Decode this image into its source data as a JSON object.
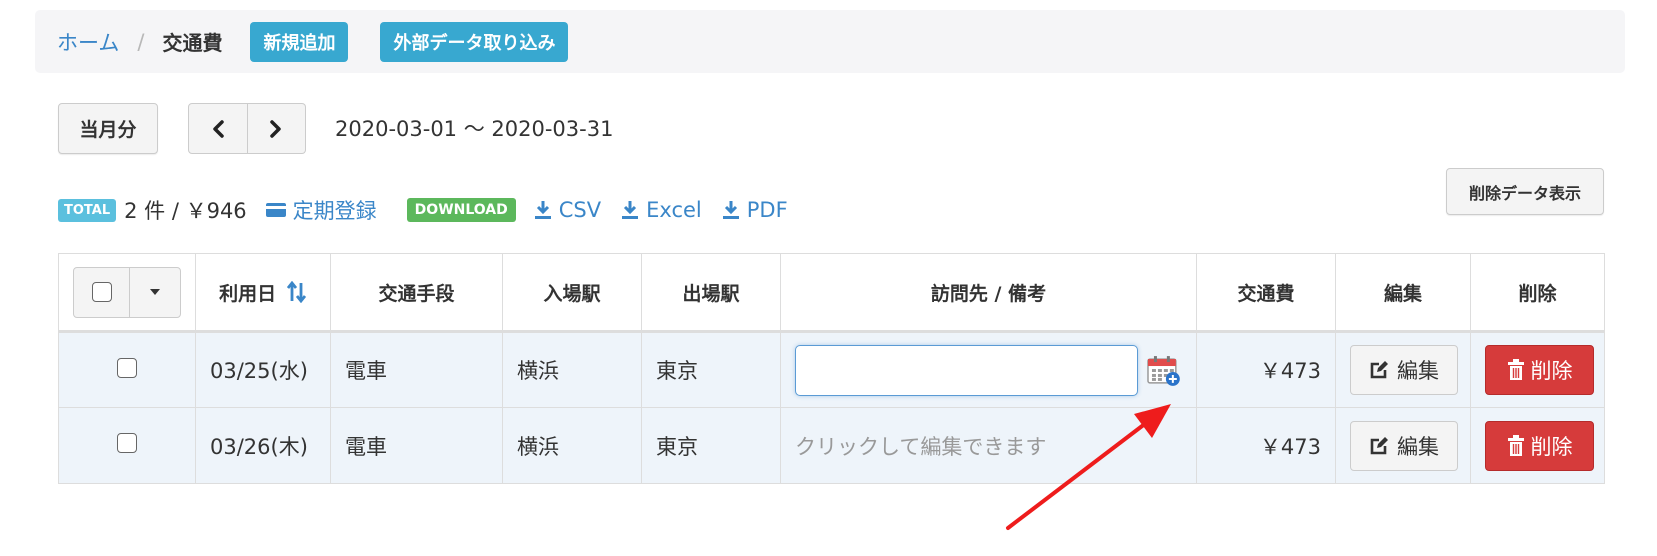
{
  "breadcrumb": {
    "home": "ホーム",
    "separator": "/",
    "current": "交通費",
    "new_button": "新規追加",
    "import_button": "外部データ取り込み"
  },
  "period": {
    "current_month_button": "当月分",
    "prev_icon": "chevron-left-icon",
    "next_icon": "chevron-right-icon",
    "range": "2020-03-01 ～ 2020-03-31"
  },
  "summary": {
    "total_badge": "TOTAL",
    "count_text": "2 件 / ￥946",
    "commuter_link": "定期登録",
    "download_badge": "DOWNLOAD",
    "csv": "CSV",
    "excel": "Excel",
    "pdf": "PDF"
  },
  "deleted_data_button": "削除データ表示",
  "table": {
    "headers": {
      "date": "利用日",
      "transport": "交通手段",
      "entry": "入場駅",
      "exit": "出場駅",
      "note": "訪問先 / 備考",
      "fare": "交通費",
      "edit": "編集",
      "delete": "削除"
    },
    "rows": [
      {
        "date": "03/25(水)",
        "transport": "電車",
        "entry": "横浜",
        "exit": "東京",
        "note": "",
        "fare": "￥473",
        "edit": "編集",
        "delete": "削除"
      },
      {
        "date": "03/26(木)",
        "transport": "電車",
        "entry": "横浜",
        "exit": "東京",
        "note": "クリックして編集できます",
        "fare": "￥473",
        "edit": "編集",
        "delete": "削除"
      }
    ]
  },
  "colors": {
    "info": "#38a8d0",
    "danger": "#d63b3b",
    "link": "#3a86c8",
    "success": "#5cb85c",
    "arrow": "#ee1c1c"
  }
}
